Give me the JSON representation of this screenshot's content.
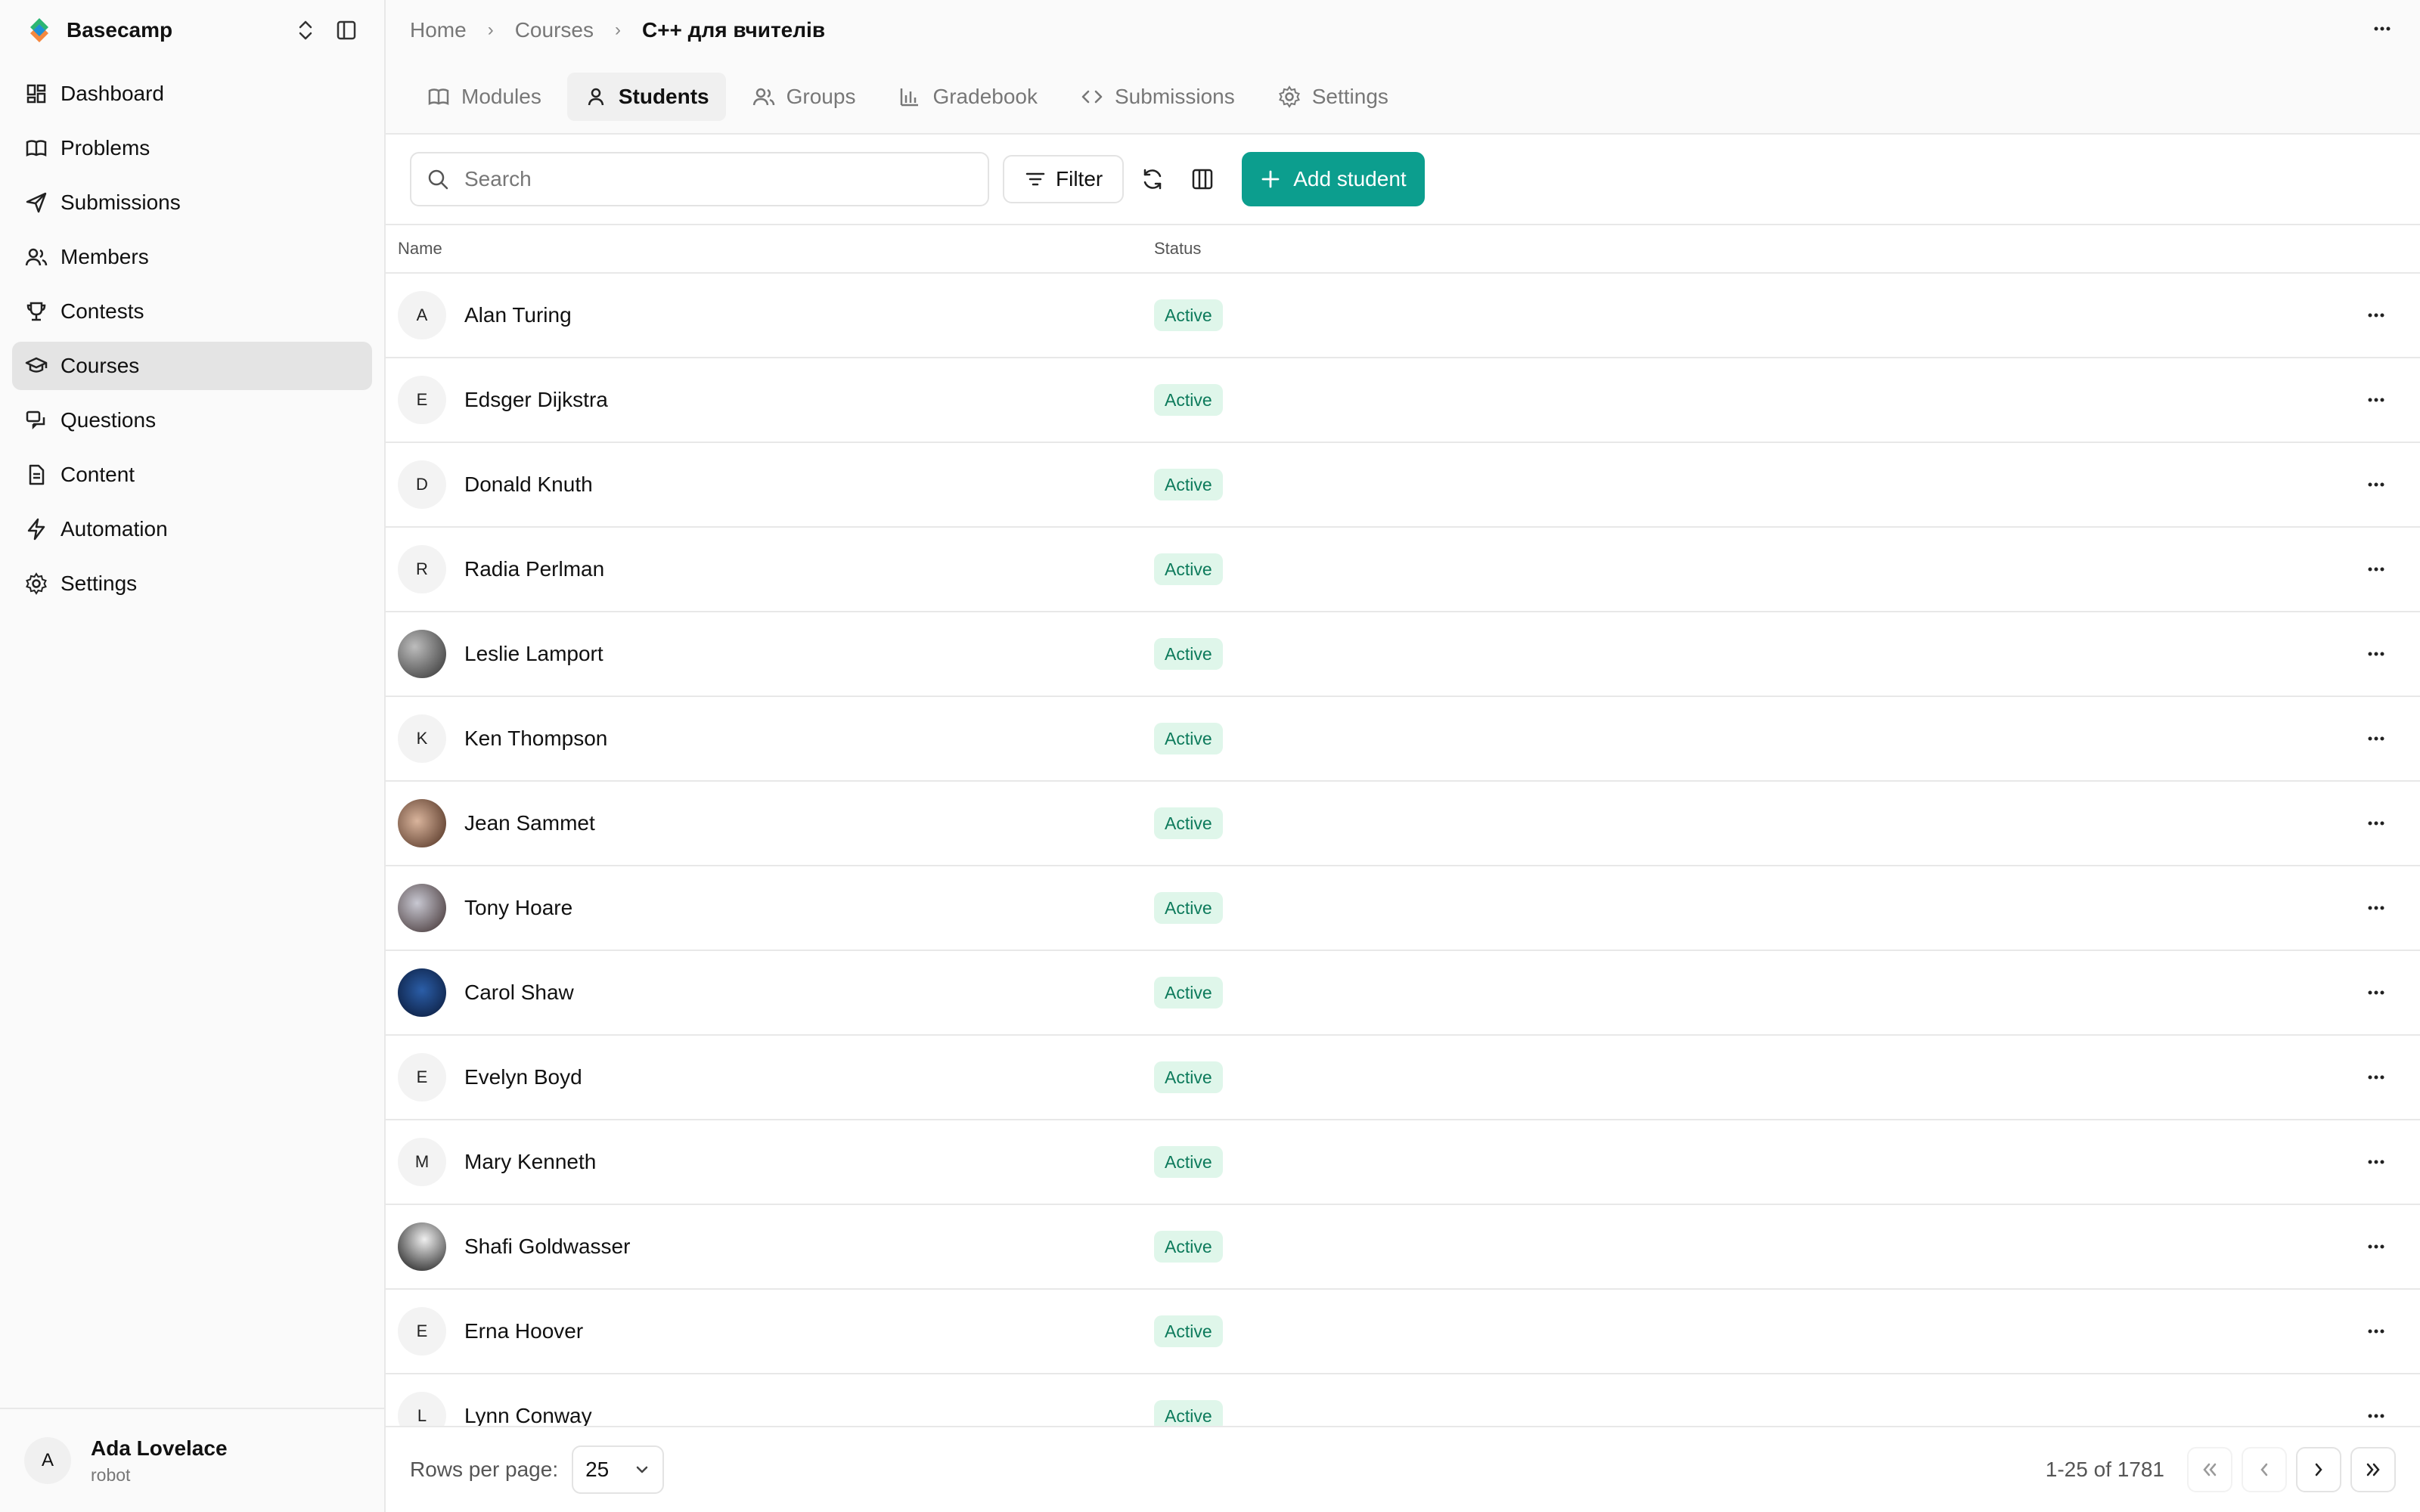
{
  "app": {
    "name": "Basecamp",
    "colors": {
      "accent": "#0c9e8e",
      "badge_bg": "#dff6ea",
      "badge_text": "#0c7a5b"
    }
  },
  "sidebar": {
    "items": [
      {
        "label": "Dashboard",
        "icon": "dashboard-icon"
      },
      {
        "label": "Problems",
        "icon": "book-icon"
      },
      {
        "label": "Submissions",
        "icon": "send-icon"
      },
      {
        "label": "Members",
        "icon": "members-icon"
      },
      {
        "label": "Contests",
        "icon": "trophy-icon"
      },
      {
        "label": "Courses",
        "icon": "graduation-cap-icon",
        "active": true
      },
      {
        "label": "Questions",
        "icon": "questions-icon"
      },
      {
        "label": "Content",
        "icon": "document-icon"
      },
      {
        "label": "Automation",
        "icon": "lightning-icon"
      },
      {
        "label": "Settings",
        "icon": "gear-icon"
      }
    ],
    "user": {
      "initial": "A",
      "name": "Ada Lovelace",
      "role": "robot"
    }
  },
  "breadcrumb": [
    {
      "label": "Home"
    },
    {
      "label": "Courses"
    },
    {
      "label": "C++ для вчителів"
    }
  ],
  "tabs": [
    {
      "label": "Modules",
      "icon": "book-icon"
    },
    {
      "label": "Students",
      "icon": "user-icon",
      "active": true
    },
    {
      "label": "Groups",
      "icon": "users-icon"
    },
    {
      "label": "Gradebook",
      "icon": "chart-icon"
    },
    {
      "label": "Submissions",
      "icon": "code-icon"
    },
    {
      "label": "Settings",
      "icon": "gear-icon"
    }
  ],
  "toolbar": {
    "search_placeholder": "Search",
    "filter_label": "Filter",
    "add_label": "Add student"
  },
  "table": {
    "headers": {
      "name": "Name",
      "status": "Status"
    },
    "rows": [
      {
        "initial": "A",
        "name": "Alan Turing",
        "status": "Active"
      },
      {
        "initial": "E",
        "name": "Edsger Dijkstra",
        "status": "Active"
      },
      {
        "initial": "D",
        "name": "Donald Knuth",
        "status": "Active"
      },
      {
        "initial": "R",
        "name": "Radia Perlman",
        "status": "Active"
      },
      {
        "initial": "",
        "name": "Leslie Lamport",
        "status": "Active",
        "photo": "photo"
      },
      {
        "initial": "K",
        "name": "Ken Thompson",
        "status": "Active"
      },
      {
        "initial": "",
        "name": "Jean Sammet",
        "status": "Active",
        "photo": "photo2"
      },
      {
        "initial": "",
        "name": "Tony Hoare",
        "status": "Active",
        "photo": "photo3"
      },
      {
        "initial": "",
        "name": "Carol Shaw",
        "status": "Active",
        "photo": "photo4"
      },
      {
        "initial": "E",
        "name": "Evelyn Boyd",
        "status": "Active"
      },
      {
        "initial": "M",
        "name": "Mary Kenneth",
        "status": "Active"
      },
      {
        "initial": "",
        "name": "Shafi Goldwasser",
        "status": "Active",
        "photo": "photo5"
      },
      {
        "initial": "E",
        "name": "Erna Hoover",
        "status": "Active"
      },
      {
        "initial": "L",
        "name": "Lynn Conway",
        "status": "Active"
      }
    ]
  },
  "footer": {
    "rows_per_page_label": "Rows per page:",
    "rows_per_page_value": "25",
    "range": "1-25 of 1781"
  }
}
